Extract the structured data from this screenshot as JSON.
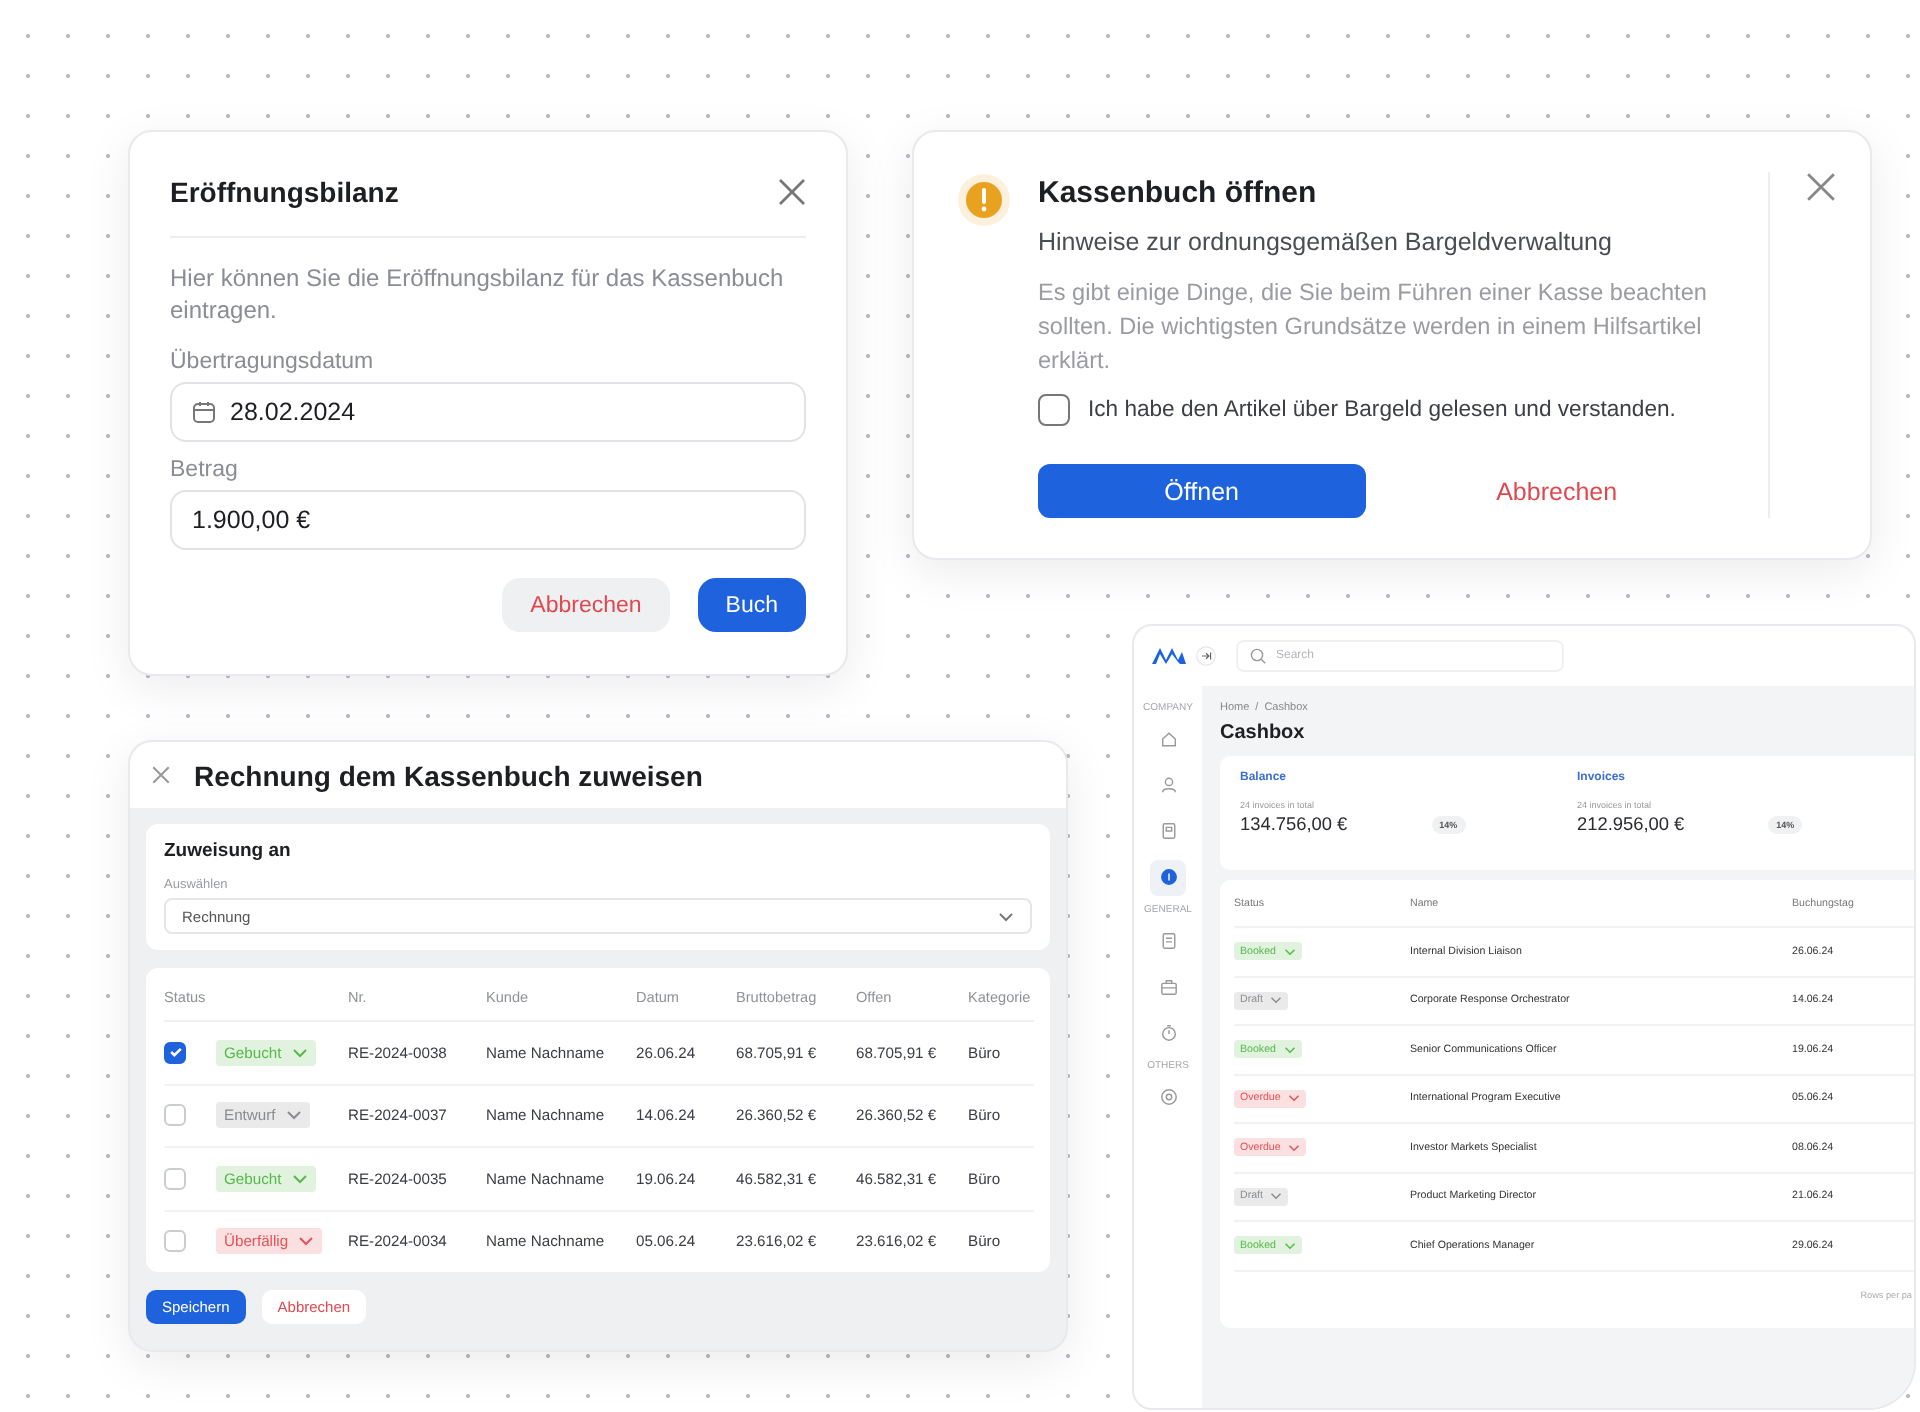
{
  "opening_balance": {
    "title": "Eröffnungsbilanz",
    "description": "Hier können Sie die Eröffnungsbilanz für das Kassenbuch eintragen.",
    "date_field": {
      "label": "Übertragungsdatum",
      "value": "28.02.2024"
    },
    "amount_field": {
      "label": "Betrag",
      "value": "1.900,00 €"
    },
    "buttons": [
      {
        "label": "Abbrechen",
        "kind": "secondary"
      },
      {
        "label": "Buch",
        "kind": "primary"
      }
    ]
  },
  "open_cashbook": {
    "title": "Kassenbuch öffnen",
    "subtitle": "Hinweise zur ordnungsgemäßen Bargeldverwaltung",
    "description": "Es gibt einige Dinge, die Sie beim Führen einer Kasse beachten sollten. Die wichtigsten Grundsätze werden in einem Hilfsartikel erklärt.",
    "confirm": {
      "label": "Ich habe den Artikel über Bargeld gelesen und verstanden.",
      "checked": false
    },
    "buttons": [
      {
        "label": "Öffnen",
        "kind": "primary"
      },
      {
        "label": "Abbrechen",
        "kind": "text"
      }
    ]
  },
  "assign_invoice": {
    "title": "Rechnung dem Kassenbuch zuweisen",
    "section_title": "Zuweisung an",
    "select": {
      "label": "Auswählen",
      "value": "Rechnung"
    },
    "columns": [
      "Status",
      "Nr.",
      "Kunde",
      "Datum",
      "Bruttobetrag",
      "Offen",
      "Kategorie"
    ],
    "rows": [
      {
        "checked": true,
        "status": {
          "label": "Gebucht",
          "color": "#56b94a"
        },
        "number": "RE-2024-0038",
        "customer": "Name Nachname",
        "date": "26.06.24",
        "gross": "68.705,91 €",
        "open": "68.705,91 €",
        "category": "Büro"
      },
      {
        "checked": false,
        "status": {
          "label": "Entwurf",
          "color": "#8a8c90"
        },
        "number": "RE-2024-0037",
        "customer": "Name Nachname",
        "date": "14.06.24",
        "gross": "26.360,52 €",
        "open": "26.360,52 €",
        "category": "Büro"
      },
      {
        "checked": false,
        "status": {
          "label": "Gebucht",
          "color": "#56b94a"
        },
        "number": "RE-2024-0035",
        "customer": "Name Nachname",
        "date": "19.06.24",
        "gross": "46.582,31 €",
        "open": "46.582,31 €",
        "category": "Büro"
      },
      {
        "checked": false,
        "status": {
          "label": "Überfällig",
          "color": "#e25359"
        },
        "number": "RE-2024-0034",
        "customer": "Name Nachname",
        "date": "05.06.24",
        "gross": "23.616,02 €",
        "open": "23.616,02 €",
        "category": "Büro"
      }
    ],
    "buttons": [
      {
        "label": "Speichern",
        "kind": "primary"
      },
      {
        "label": "Abbrechen",
        "kind": "outline"
      }
    ]
  },
  "cashbox": {
    "search_placeholder": "Search",
    "sidebar": [
      {
        "label": "COMPANY",
        "items": [
          {
            "selected": false
          },
          {
            "selected": false
          },
          {
            "selected": false
          },
          {
            "selected": true
          }
        ]
      },
      {
        "label": "GENERAL",
        "items": [
          {
            "selected": false
          },
          {
            "selected": false
          },
          {
            "selected": false
          }
        ]
      },
      {
        "label": "OTHERS",
        "items": [
          {
            "selected": false
          }
        ]
      }
    ],
    "breadcrumb": [
      "Home",
      "/",
      "Cashbox"
    ],
    "title": "Cashbox",
    "stats": [
      {
        "title": "Balance",
        "subtitle": "24 invoices in total",
        "value": "134.756,00 €",
        "badge": "14%"
      },
      {
        "title": "Invoices",
        "subtitle": "24 invoices in total",
        "value": "212.956,00 €",
        "badge": "14%"
      }
    ],
    "columns": [
      "Status",
      "Name",
      "Buchungstag"
    ],
    "rows": [
      {
        "status": {
          "label": "Booked",
          "color": "#56b94a"
        },
        "name": "Internal Division Liaison",
        "date": "26.06.24"
      },
      {
        "status": {
          "label": "Draft",
          "color": "#8a8c90"
        },
        "name": "Corporate Response Orchestrator",
        "date": "14.06.24"
      },
      {
        "status": {
          "label": "Booked",
          "color": "#56b94a"
        },
        "name": "Senior Communications Officer",
        "date": "19.06.24"
      },
      {
        "status": {
          "label": "Overdue",
          "color": "#e25359"
        },
        "name": "International Program Executive",
        "date": "05.06.24"
      },
      {
        "status": {
          "label": "Overdue",
          "color": "#e25359"
        },
        "name": "Investor Markets Specialist",
        "date": "08.06.24"
      },
      {
        "status": {
          "label": "Draft",
          "color": "#8a8c90"
        },
        "name": "Product Marketing Director",
        "date": "21.06.24"
      },
      {
        "status": {
          "label": "Booked",
          "color": "#56b94a"
        },
        "name": "Chief Operations Manager",
        "date": "29.06.24"
      }
    ],
    "footer": "Rows per pa"
  }
}
